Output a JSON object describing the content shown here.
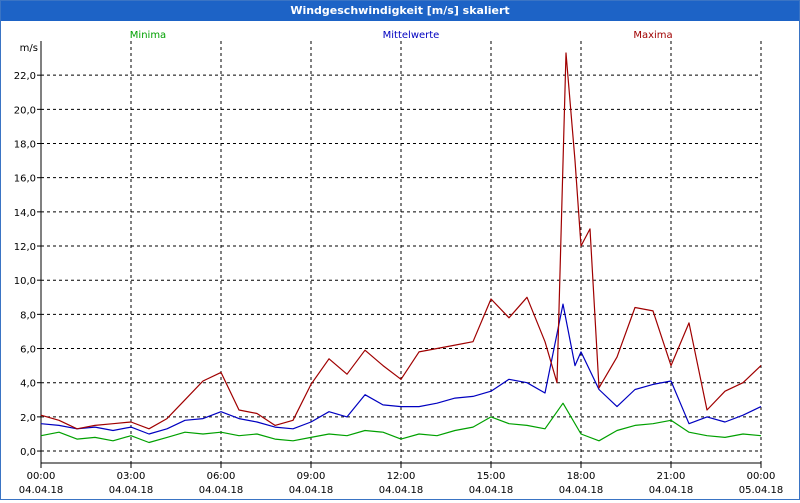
{
  "window": {
    "title": "Windgeschwindigkeit [m/s] skaliert"
  },
  "chart_data": {
    "type": "line",
    "title": "Windgeschwindigkeit [m/s] skaliert",
    "ylabel": "m/s",
    "ylim": [
      -0.7,
      24.0
    ],
    "xlim_hours": [
      0,
      24
    ],
    "yticks": [
      "0,0",
      "2,0",
      "4,0",
      "6,0",
      "8,0",
      "10,0",
      "12,0",
      "14,0",
      "16,0",
      "18,0",
      "20,0",
      "22,0"
    ],
    "ytick_values": [
      0,
      2,
      4,
      6,
      8,
      10,
      12,
      14,
      16,
      18,
      20,
      22
    ],
    "xticks": [
      {
        "time": "00:00",
        "date": "04.04.18",
        "h": 0
      },
      {
        "time": "03:00",
        "date": "04.04.18",
        "h": 3
      },
      {
        "time": "06:00",
        "date": "04.04.18",
        "h": 6
      },
      {
        "time": "09:00",
        "date": "04.04.18",
        "h": 9
      },
      {
        "time": "12:00",
        "date": "04.04.18",
        "h": 12
      },
      {
        "time": "15:00",
        "date": "04.04.18",
        "h": 15
      },
      {
        "time": "18:00",
        "date": "04.04.18",
        "h": 18
      },
      {
        "time": "21:00",
        "date": "04.04.18",
        "h": 21
      },
      {
        "time": "00:00",
        "date": "05.04.18",
        "h": 24
      }
    ],
    "grid": true,
    "legend_position": "top",
    "series": [
      {
        "name": "Minima",
        "color": "#00a000",
        "x": [
          0,
          0.6,
          1.2,
          1.8,
          2.4,
          3.0,
          3.6,
          4.2,
          4.8,
          5.4,
          6.0,
          6.6,
          7.2,
          7.8,
          8.4,
          9.0,
          9.6,
          10.2,
          10.8,
          11.4,
          12.0,
          12.6,
          13.2,
          13.8,
          14.4,
          15.0,
          15.6,
          16.2,
          16.8,
          17.4,
          18.0,
          18.6,
          19.2,
          19.8,
          20.4,
          21.0,
          21.6,
          22.2,
          22.8,
          23.4,
          24.0
        ],
        "y": [
          0.9,
          1.1,
          0.7,
          0.8,
          0.6,
          0.9,
          0.5,
          0.8,
          1.1,
          1.0,
          1.1,
          0.9,
          1.0,
          0.7,
          0.6,
          0.8,
          1.0,
          0.9,
          1.2,
          1.1,
          0.7,
          1.0,
          0.9,
          1.2,
          1.4,
          2.0,
          1.6,
          1.5,
          1.3,
          2.8,
          1.0,
          0.6,
          1.2,
          1.5,
          1.6,
          1.8,
          1.1,
          0.9,
          0.8,
          1.0,
          0.9
        ]
      },
      {
        "name": "Mittelwerte",
        "color": "#0000c0",
        "x": [
          0,
          0.6,
          1.2,
          1.8,
          2.4,
          3.0,
          3.6,
          4.2,
          4.8,
          5.4,
          6.0,
          6.6,
          7.2,
          7.8,
          8.4,
          9.0,
          9.6,
          10.2,
          10.8,
          11.4,
          12.0,
          12.6,
          13.2,
          13.8,
          14.4,
          15.0,
          15.6,
          16.2,
          16.8,
          17.4,
          17.8,
          18.0,
          18.6,
          19.2,
          19.8,
          20.4,
          21.0,
          21.6,
          22.2,
          22.8,
          23.4,
          24.0
        ],
        "y": [
          1.6,
          1.5,
          1.3,
          1.4,
          1.2,
          1.4,
          1.0,
          1.3,
          1.8,
          1.9,
          2.3,
          1.9,
          1.7,
          1.4,
          1.3,
          1.7,
          2.3,
          2.0,
          3.3,
          2.7,
          2.6,
          2.6,
          2.8,
          3.1,
          3.2,
          3.5,
          4.2,
          4.0,
          3.4,
          8.6,
          5.0,
          5.8,
          3.6,
          2.6,
          3.6,
          3.9,
          4.1,
          1.6,
          2.0,
          1.7,
          2.1,
          2.6
        ]
      },
      {
        "name": "Maxima",
        "color": "#a00000",
        "x": [
          0,
          0.6,
          1.2,
          1.8,
          2.4,
          3.0,
          3.6,
          4.2,
          4.8,
          5.4,
          6.0,
          6.6,
          7.2,
          7.8,
          8.4,
          9.0,
          9.6,
          10.2,
          10.8,
          11.4,
          12.0,
          12.6,
          13.2,
          13.8,
          14.4,
          15.0,
          15.6,
          16.2,
          16.8,
          17.2,
          17.5,
          17.8,
          18.0,
          18.3,
          18.6,
          19.2,
          19.8,
          20.4,
          21.0,
          21.6,
          22.2,
          22.8,
          23.4,
          24.0
        ],
        "y": [
          2.1,
          1.8,
          1.3,
          1.5,
          1.6,
          1.7,
          1.3,
          1.9,
          3.0,
          4.1,
          4.6,
          2.4,
          2.2,
          1.5,
          1.8,
          3.9,
          5.4,
          4.5,
          5.9,
          5.0,
          4.2,
          5.8,
          6.0,
          6.2,
          6.4,
          8.9,
          7.8,
          9.0,
          6.4,
          4.0,
          23.3,
          17.0,
          12.0,
          13.0,
          3.7,
          5.5,
          8.4,
          8.2,
          5.0,
          7.5,
          2.4,
          3.5,
          4.0,
          5.0
        ]
      }
    ]
  }
}
